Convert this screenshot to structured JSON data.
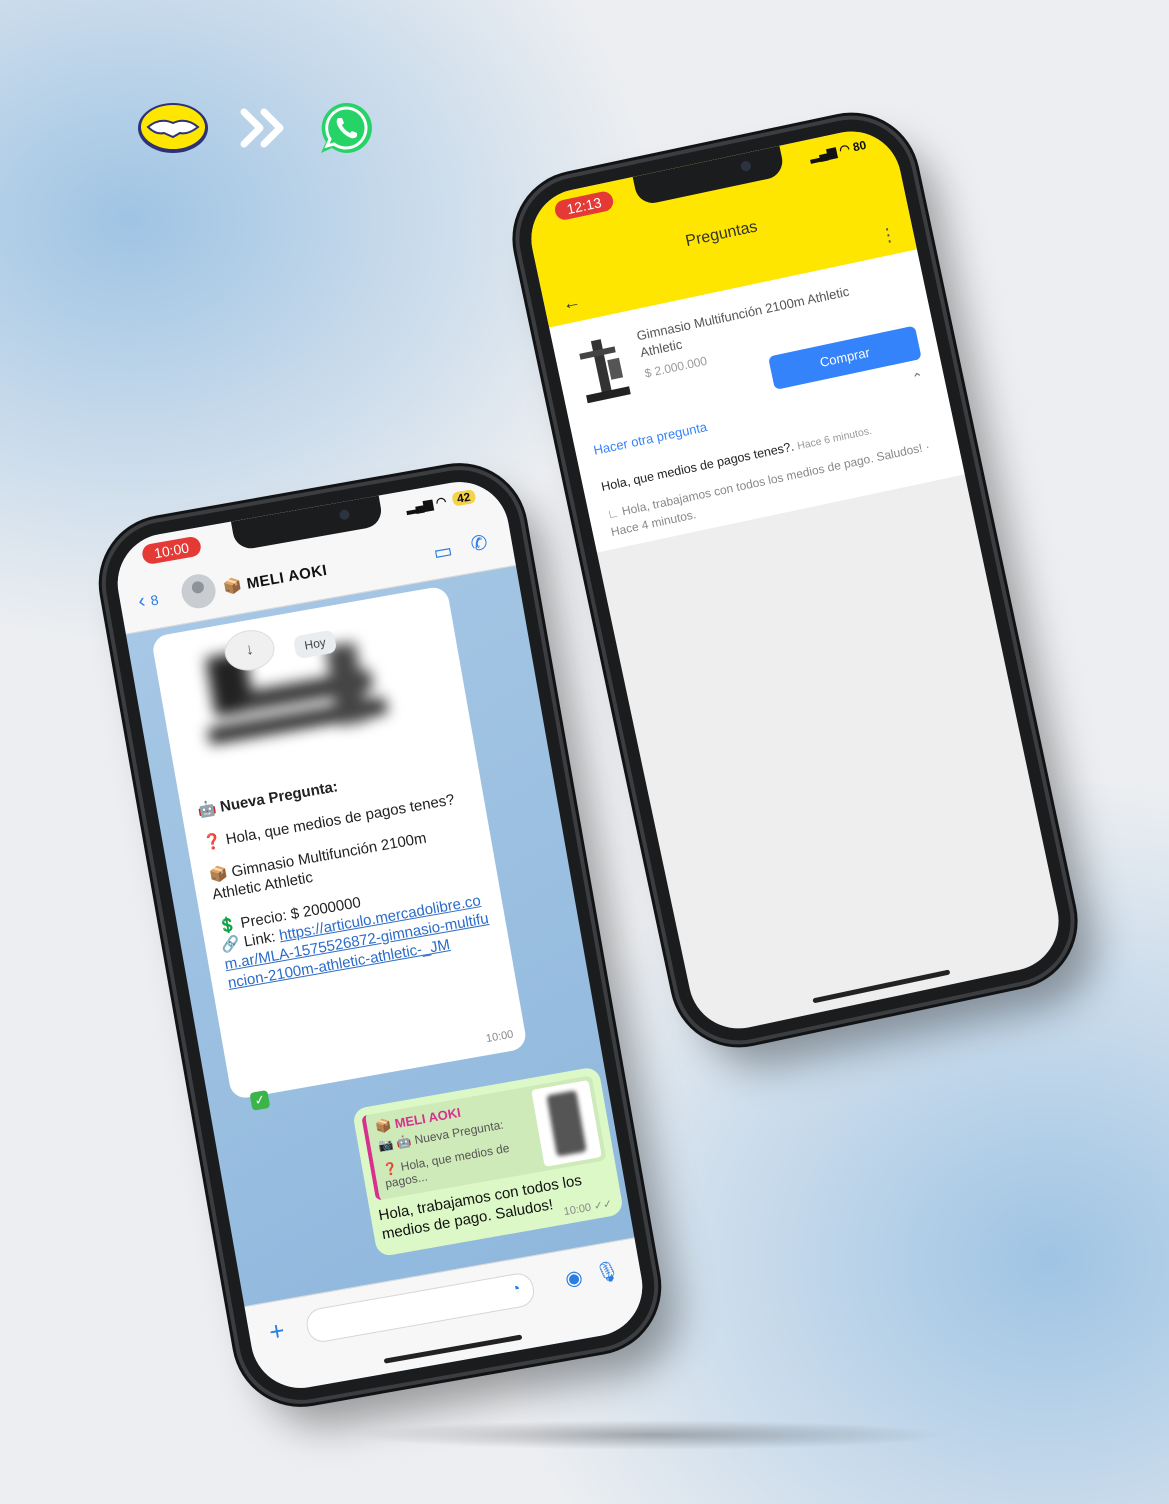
{
  "icons": {
    "mercadolibre": "handshake-logo",
    "arrows": "double-chevron-right",
    "whatsapp": "whatsapp-logo"
  },
  "colors": {
    "ml_yellow": "#ffe600",
    "ml_blue": "#3483fa",
    "wa_green": "#dcf8c6",
    "ios_blue": "#2a7de1",
    "status_red": "#e53935"
  },
  "whatsapp": {
    "status_time": "10:00",
    "battery": "42",
    "back_count": "8",
    "contact_name": "📦 MELI AOKI",
    "date_chip": "Hoy",
    "incoming": {
      "header": "🤖 Nueva Pregunta:",
      "question": "❓ Hola, que medios de pagos tenes?",
      "product": "📦 Gimnasio Multifunción 2100m Athletic Athletic",
      "price": "💲 Precio: $ 2000000",
      "link_label": "🔗 Link: ",
      "link": "https://articulo.mercadolibre.com.ar/MLA-1575526872-gimnasio-multifuncion-2100m-athletic-athletic-_JM",
      "time": "10:00"
    },
    "outgoing": {
      "quote_name": "📦 MELI AOKI",
      "quote_line1": "📷 🤖 Nueva Pregunta:",
      "quote_line2": "❓ Hola, que medios de pagos...",
      "text": "Hola, trabajamos con todos los medios de pago. Saludos!",
      "time": "10:00 ✓✓"
    }
  },
  "mercadolibre": {
    "status_time": "12:13",
    "battery": "80",
    "title": "Preguntas",
    "product": "Gimnasio Multifunción 2100m Athletic Athletic",
    "price": "$ 2.000.000",
    "buy_button": "Comprar",
    "ask_link": "Hacer otra pregunta",
    "question": "Hola, que medios de pagos tenes?.",
    "question_ago": "Hace 6 minutos.",
    "answer": "Hola, trabajamos con todos los medios de pago. Saludos!",
    "answer_ago": "· Hace 4 minutos."
  }
}
